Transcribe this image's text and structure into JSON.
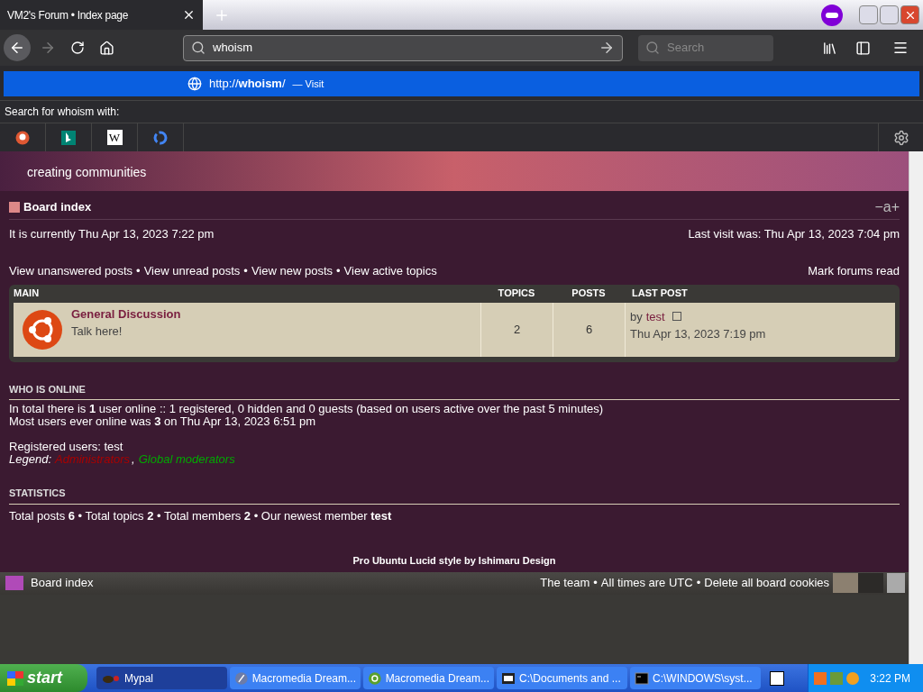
{
  "browser": {
    "tab": {
      "title": "VM2's Forum • Index page",
      "selected": true
    },
    "url_field": {
      "value": "whoism"
    },
    "search_field": {
      "placeholder": "Search"
    },
    "suggestion": {
      "prefix": "http://",
      "bold": "whoism",
      "suffix": "/",
      "action": "— Visit",
      "selected": true
    },
    "search_with": "Search for whoism with:",
    "engines": [
      {
        "kind": "duckduckgo"
      },
      {
        "kind": "bing"
      },
      {
        "kind": "wikipedia",
        "glyph": "W"
      },
      {
        "kind": "google"
      }
    ]
  },
  "forum": {
    "tagline": "creating communities",
    "breadcrumb": "Board index",
    "font_size_control": "−a+",
    "separator": "•",
    "legend_separator": ",",
    "current_time": "It is currently Thu Apr 13, 2023 7:22 pm",
    "last_visit": "Last visit was: Thu Apr 13, 2023 7:04 pm",
    "quick_links": [
      "View unanswered posts",
      "View unread posts",
      "View new posts",
      "View active topics"
    ],
    "mark_read": "Mark forums read",
    "table": {
      "columns": [
        "MAIN",
        "TOPICS",
        "POSTS",
        "LAST POST"
      ],
      "rows": [
        {
          "title": "General Discussion",
          "description": "Talk here!",
          "topics": "2",
          "posts": "6",
          "by": "by",
          "author": "test",
          "time": "Thu Apr 13, 2023 7:19 pm"
        }
      ]
    },
    "online": {
      "heading": "WHO IS ONLINE",
      "lines": [
        "In total there is **1** user online :: 1 registered, 0 hidden and 0 guests (based on users active over the past 5 minutes)",
        "Most users ever online was **3** on Thu Apr 13, 2023 6:51 pm"
      ],
      "registered": "Registered users: test",
      "legend_label": "Legend:",
      "legend": [
        {
          "text": "Administrators",
          "color": "#aa0000"
        },
        {
          "text": "Global moderators",
          "color": "#00aa00"
        }
      ]
    },
    "statistics": {
      "heading": "STATISTICS",
      "text": "Total posts **6** • Total topics **2** • Total members **2** • Our newest member **test**"
    },
    "credit": "Pro Ubuntu Lucid style by Ishimaru Design",
    "footer": {
      "home": "Board index",
      "links": [
        "The team",
        "All times are UTC",
        "Delete all board cookies"
      ]
    }
  },
  "taskbar": {
    "start": "start",
    "tasks": [
      {
        "label": "Mypal",
        "kind": "mypal",
        "selected": true
      },
      {
        "label": "Macromedia Dream...",
        "kind": "dw",
        "selected": false
      },
      {
        "label": "Macromedia Dream...",
        "kind": "dwg",
        "selected": false
      },
      {
        "label": "C:\\Documents and ...",
        "kind": "archive",
        "selected": false
      },
      {
        "label": "C:\\WINDOWS\\syst...",
        "kind": "cmd",
        "selected": false
      }
    ],
    "clock": "3:22 PM"
  }
}
